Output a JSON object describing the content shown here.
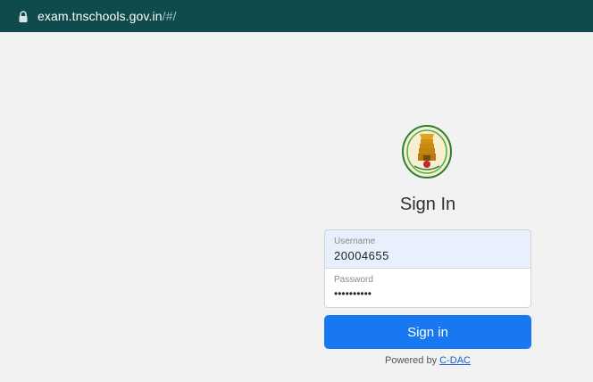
{
  "browser": {
    "url_host": "exam.tnschools.gov.in",
    "url_path": "/#/"
  },
  "login": {
    "title": "Sign In",
    "username": {
      "label": "Username",
      "value": "20004655"
    },
    "password": {
      "label": "Password",
      "value": "••••••••••"
    },
    "signin_button": "Sign in",
    "powered_by_prefix": "Powered by",
    "powered_by_link": "C-DAC"
  },
  "colors": {
    "address_bar": "#0f4a4d",
    "button": "#1778f2",
    "username_bg": "#e8f0fe"
  },
  "icons": [
    "lock-icon",
    "emblem-logo"
  ]
}
